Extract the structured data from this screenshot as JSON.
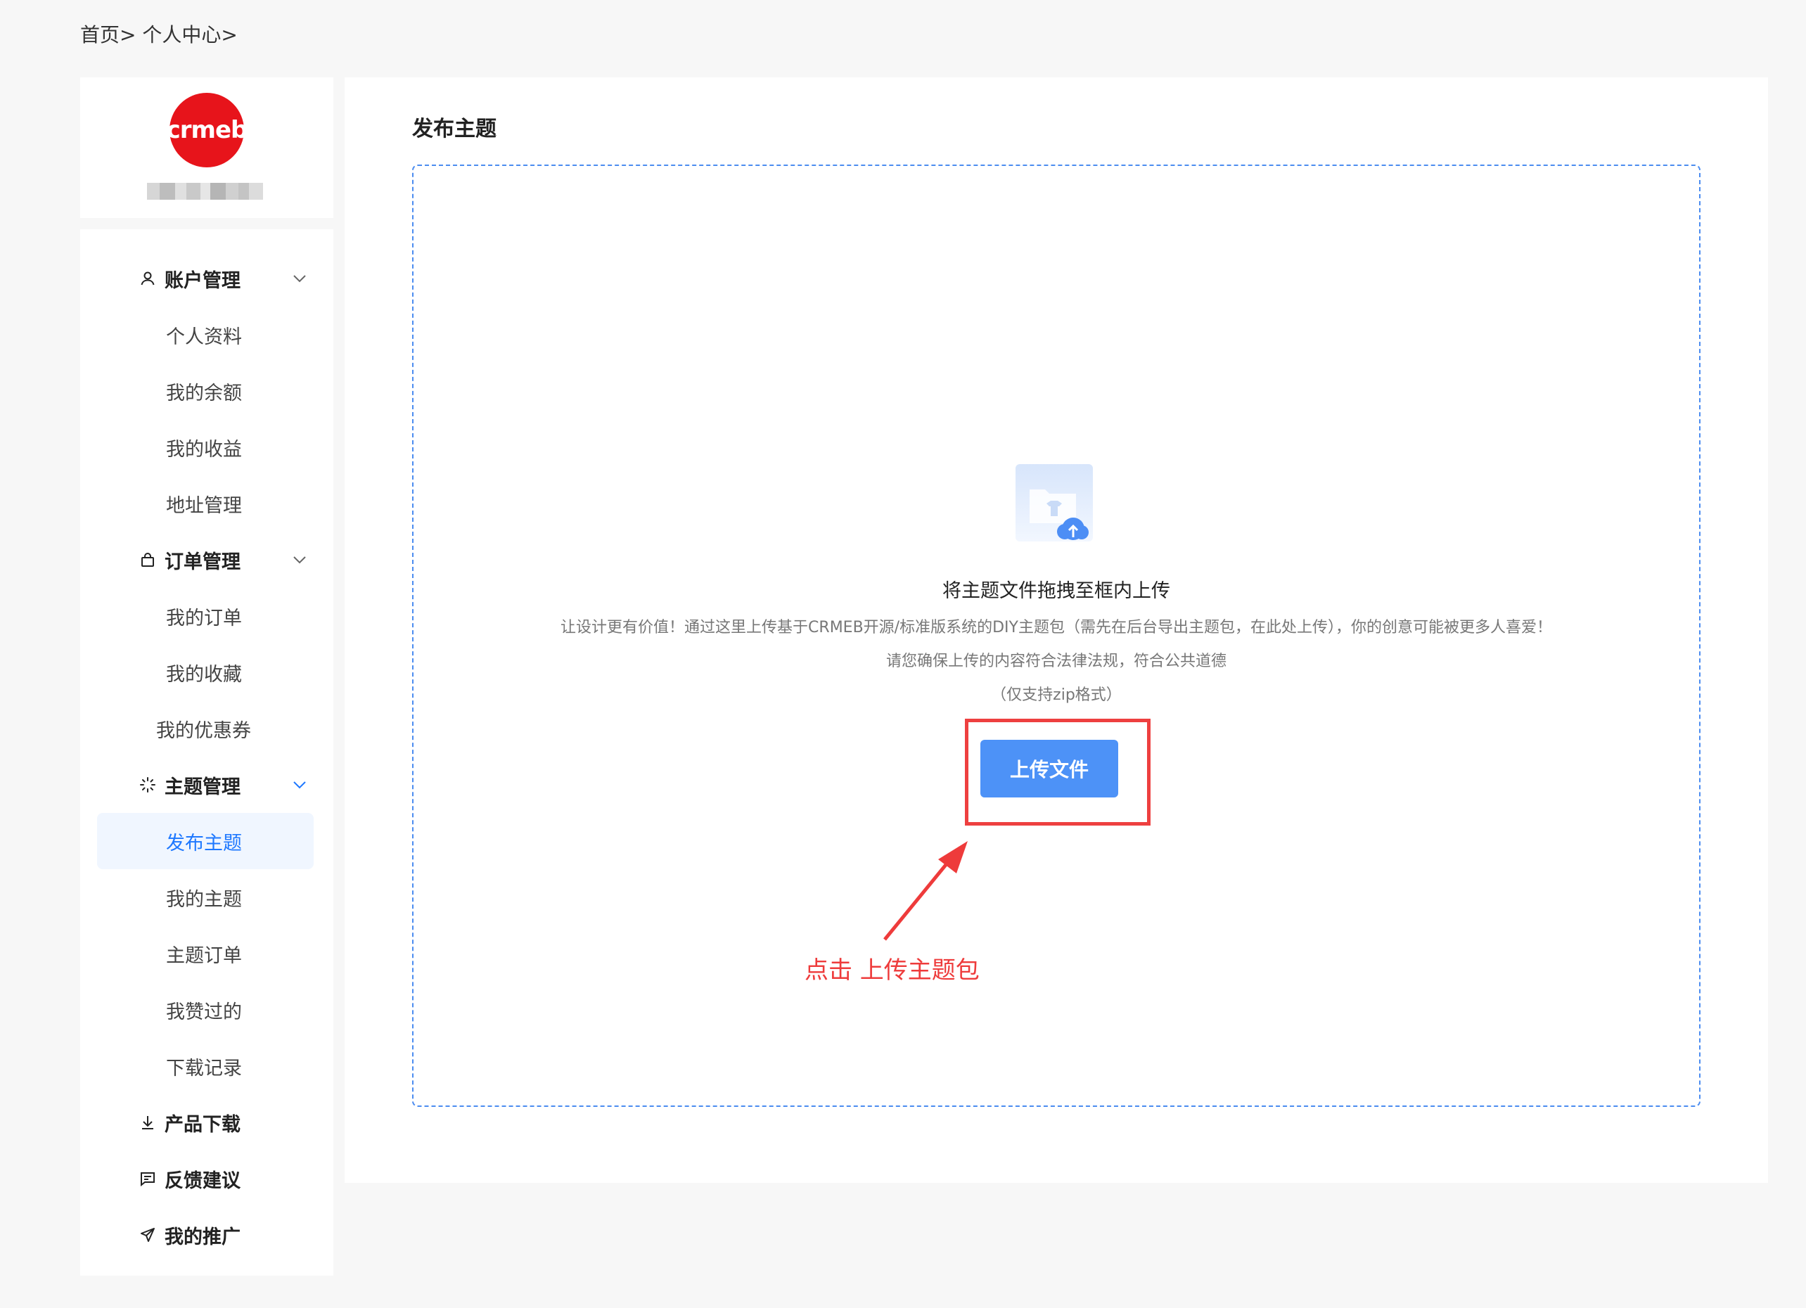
{
  "breadcrumb": "首页> 个人中心>",
  "profile": {
    "logo_text": "crmeb",
    "logo_color": "#e7141b"
  },
  "sidebar": {
    "groups": [
      {
        "label": "账户管理",
        "icon": "user-icon",
        "items": [
          "个人资料",
          "我的余额",
          "我的收益",
          "地址管理"
        ]
      },
      {
        "label": "订单管理",
        "icon": "shopping-bag-icon",
        "items": [
          "我的订单",
          "我的收藏",
          "我的优惠券"
        ]
      },
      {
        "label": "主题管理",
        "icon": "loading-sparkle-icon",
        "items": [
          "发布主题",
          "我的主题",
          "主题订单",
          "我赞过的",
          "下载记录"
        ],
        "active_item": "发布主题"
      },
      {
        "label": "产品下载",
        "icon": "download-icon"
      },
      {
        "label": "反馈建议",
        "icon": "message-icon"
      },
      {
        "label": "我的推广",
        "icon": "send-icon"
      }
    ]
  },
  "main": {
    "title": "发布主题",
    "upload": {
      "title": "将主题文件拖拽至框内上传",
      "desc_line1": "让设计更有价值！通过这里上传基于CRMEB开源/标准版系统的DIY主题包（需先在后台导出主题包，在此处上传），你的创意可能被更多人喜爱！",
      "desc_line2": "请您确保上传的内容符合法律法规，符合公共道德",
      "desc_line3": "（仅支持zip格式）",
      "button_label": "上传文件"
    },
    "annotation": "点击 上传主题包"
  },
  "colors": {
    "accent": "#1e78ff",
    "button": "#4d92f7",
    "annotation_red": "#ee3b3b"
  }
}
